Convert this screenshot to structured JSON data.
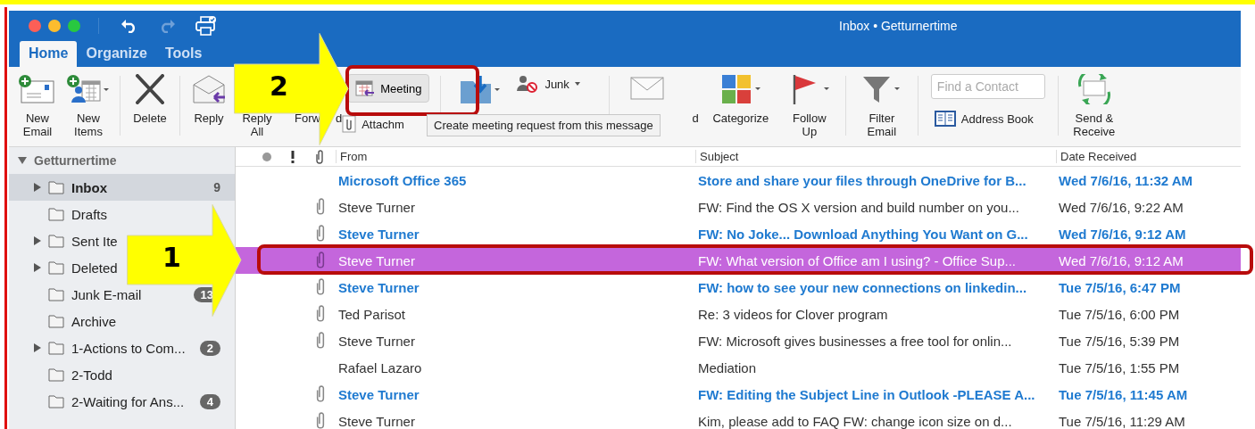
{
  "window": {
    "title": "Inbox • Getturnertime"
  },
  "tabs": [
    {
      "label": "Home",
      "selected": true
    },
    {
      "label": "Organize",
      "selected": false
    },
    {
      "label": "Tools",
      "selected": false
    }
  ],
  "ribbon": {
    "new_email": "New\nEmail",
    "new_items": "New\nItems",
    "delete": "Delete",
    "reply": "Reply",
    "reply_all": "Reply\nAll",
    "forward": "Forw",
    "forward_end": "d",
    "meeting": "Meeting",
    "attachment": "Attachm",
    "junk": "Junk",
    "unread": "d",
    "categorize": "Categorize",
    "follow_up": "Follow\nUp",
    "filter_email": "Filter\nEmail",
    "find_contact": {
      "placeholder": "Find a Contact"
    },
    "address_book": "Address Book",
    "send_receive": "Send &\nReceive"
  },
  "tooltip": "Create meeting request from this message",
  "sidebar": {
    "account": {
      "label": "Getturnertime",
      "expanded": true
    },
    "folders": [
      {
        "name": "Inbox",
        "count": "9",
        "badge": false,
        "collapsible": true,
        "selected": true
      },
      {
        "name": "Drafts",
        "collapsible": false,
        "selected": false
      },
      {
        "name": "Sent Ite",
        "collapsible": true,
        "selected": false
      },
      {
        "name": "Deleted",
        "collapsible": true,
        "selected": false
      },
      {
        "name": "Junk E-mail",
        "count": "13",
        "badge": true,
        "collapsible": false,
        "selected": false
      },
      {
        "name": "Archive",
        "collapsible": false,
        "selected": false
      },
      {
        "name": "1-Actions to Com...",
        "count": "2",
        "badge": true,
        "collapsible": true,
        "selected": false
      },
      {
        "name": "2-Todd",
        "collapsible": false,
        "selected": false
      },
      {
        "name": "2-Waiting for Ans...",
        "count": "4",
        "badge": true,
        "collapsible": false,
        "selected": false
      }
    ]
  },
  "columns": [
    "From",
    "Subject",
    "Date Received"
  ],
  "rows": [
    {
      "from": "Microsoft Office 365",
      "subject": "Store and share your files through OneDrive for B...",
      "date": "Wed 7/6/16, 11:32 AM",
      "unread": true,
      "attachment": false,
      "selected": false
    },
    {
      "from": "Steve Turner",
      "subject": "FW: Find the OS X version and build number on you...",
      "date": "Wed 7/6/16, 9:22 AM",
      "unread": false,
      "attachment": true,
      "selected": false
    },
    {
      "from": "Steve Turner",
      "subject": "FW: No Joke... Download Anything You Want on G...",
      "date": "Wed 7/6/16, 9:12 AM",
      "unread": true,
      "attachment": true,
      "selected": false
    },
    {
      "from": "Steve Turner",
      "subject": "FW: What version of Office am I using? - Office Sup...",
      "date": "Wed 7/6/16, 9:12 AM",
      "unread": false,
      "attachment": true,
      "selected": true
    },
    {
      "from": "Steve Turner",
      "subject": "FW: how to see your new connections on linkedin...",
      "date": "Tue 7/5/16, 6:47 PM",
      "unread": true,
      "attachment": true,
      "selected": false
    },
    {
      "from": "Ted Parisot",
      "subject": "Re: 3 videos for Clover program",
      "date": "Tue 7/5/16, 6:00 PM",
      "unread": false,
      "attachment": true,
      "selected": false
    },
    {
      "from": "Steve Turner",
      "subject": "FW: Microsoft gives businesses a free tool for onlin...",
      "date": "Tue 7/5/16, 5:39 PM",
      "unread": false,
      "attachment": true,
      "selected": false
    },
    {
      "from": "Rafael Lazaro",
      "subject": "Mediation",
      "date": "Tue 7/5/16, 1:55 PM",
      "unread": false,
      "attachment": false,
      "selected": false
    },
    {
      "from": "Steve Turner",
      "subject": "FW: Editing the Subject Line in Outlook -PLEASE A...",
      "date": "Tue 7/5/16, 11:45 AM",
      "unread": true,
      "attachment": true,
      "selected": false
    },
    {
      "from": "Steve Turner",
      "subject": "Kim, please add to FAQ  FW: change icon size on d...",
      "date": "Tue 7/5/16, 11:29 AM",
      "unread": false,
      "attachment": true,
      "selected": false
    }
  ],
  "annotations": [
    {
      "label": "1"
    },
    {
      "label": "2"
    }
  ]
}
